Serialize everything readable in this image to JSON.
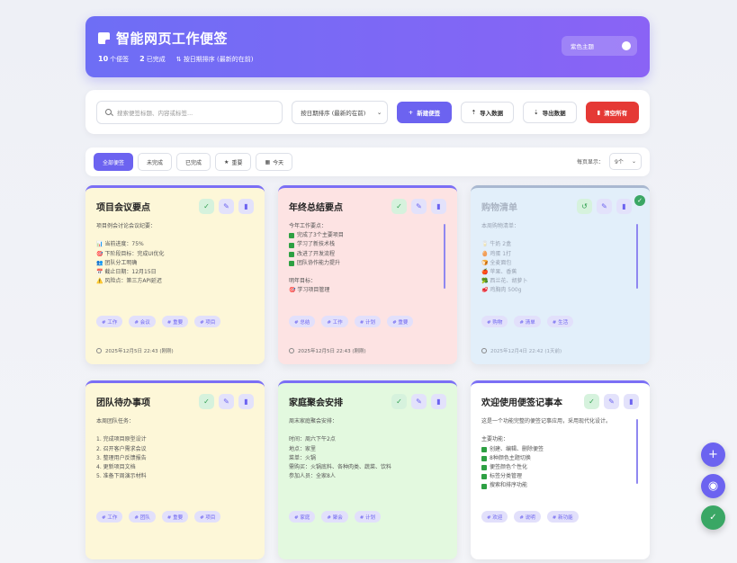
{
  "header": {
    "title": "智能网页工作便签",
    "stats": {
      "total_count": "10",
      "total_label": "个便签",
      "done_count": "2",
      "done_label": "已完成",
      "sort_label": "按日期排序 (最新的在前)"
    },
    "theme_button": "紫色主题"
  },
  "toolbar": {
    "search_placeholder": "搜索便签标题、内容或标签...",
    "sort_value": "按日期排序 (最新的在前)",
    "new_button": "新建便签",
    "import_button": "导入数据",
    "export_button": "导出数据",
    "clear_button": "清空所有"
  },
  "filters": {
    "tabs": [
      "全部便签",
      "未完成",
      "已完成",
      "重要",
      "今天"
    ],
    "per_page_label": "每页显示：",
    "per_page_value": "9个"
  },
  "notes": [
    {
      "title": "项目会议要点",
      "body": "项目例会讨论会议纪要：\n\n📊 当前进度：75%\n🎯 下阶段目标：完成UI优化\n👥 团队分工明确\n📅 截止日期：12月15日\n⚠️ 风险点：第三方API延迟",
      "tags": [
        "# 工作",
        "# 会议",
        "# 重要",
        "# 项目"
      ],
      "date": "2025年12月5日 22:43 (刚刚)",
      "color": "yellow"
    },
    {
      "title": "年终总结要点",
      "intro": "今年工作要点：",
      "checks": [
        "完成了3个主要项目",
        "学习了新技术栈",
        "改进了开发流程",
        "团队协作能力提升"
      ],
      "outro": "明年目标：",
      "outro_item": "🎯 学习项目管理",
      "tags": [
        "# 总结",
        "# 工作",
        "# 计划",
        "# 重要"
      ],
      "date": "2025年12月5日 22:43 (刚刚)",
      "color": "pink"
    },
    {
      "title": "购物清单",
      "body": "本周购物清单：\n\n🥛 牛奶 2盒\n🥚 鸡蛋 1打\n🍞 全麦面包\n🍎 苹果、香蕉\n🥦 西兰花、胡萝卜\n🥩 鸡胸肉 500g",
      "tags": [
        "# 购物",
        "# 清单",
        "# 生活"
      ],
      "date": "2025年12月4日 22:42 (1天前)",
      "color": "blue"
    },
    {
      "title": "团队待办事项",
      "body": "本周团队任务：\n\n1. 完成项目原型设计\n2. 召开客户需求会议\n3. 整理用户反馈报告\n4. 更新项目文档\n5. 准备下周演示材料",
      "tags": [
        "# 工作",
        "# 团队",
        "# 重要",
        "# 项目"
      ],
      "date": "",
      "color": "yellow"
    },
    {
      "title": "家庭聚会安排",
      "body": "周末家庭聚会安排：\n\n时间：周六下午2点\n地点：家里\n菜单：火锅\n需购买：火锅底料、各种肉类、蔬菜、饮料\n参加人员：全家8人",
      "tags": [
        "# 家庭",
        "# 聚会",
        "# 计划"
      ],
      "date": "",
      "color": "green"
    },
    {
      "title": "欢迎使用便签记事本",
      "intro": "这是一个功能完整的便签记事应用，采用现代化设计。",
      "outro": "主要功能：",
      "checks": [
        "创建、编辑、删除便签",
        "8种颜色主题切换",
        "便签颜色个性化",
        "标签分类管理",
        "搜索和排序功能"
      ],
      "tags": [
        "# 欢迎",
        "# 说明",
        "# 新功能"
      ],
      "date": "",
      "color": "white"
    }
  ],
  "icons": {
    "check": "✓",
    "edit": "✎",
    "delete": "🗑",
    "undo": "↺",
    "plus": "+",
    "palette": "◉",
    "star": "★",
    "calendar": "▦"
  }
}
